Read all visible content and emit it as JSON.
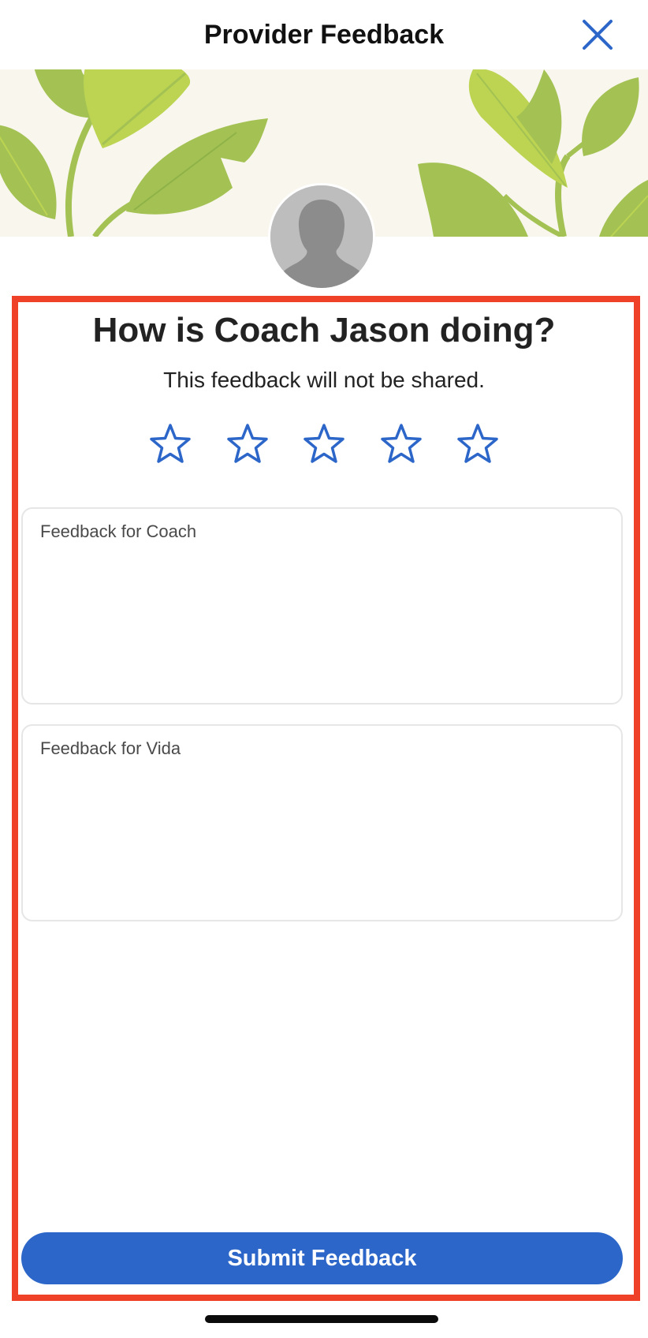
{
  "header": {
    "title": "Provider Feedback",
    "close_icon": "close-icon"
  },
  "banner": {
    "background_color": "#f9f6ee",
    "leaf_colors": [
      "#a3c253",
      "#bcd452",
      "#8fb248"
    ]
  },
  "avatar": {
    "icon": "person-silhouette-icon"
  },
  "prompt": {
    "question": "How is Coach Jason doing?",
    "subtitle": "This feedback will not be shared."
  },
  "rating": {
    "max": 5,
    "value": 0,
    "star_icon": "star-outline-icon",
    "star_color": "#2c66c9"
  },
  "fields": {
    "coach_placeholder": "Feedback for Coach",
    "coach_value": "",
    "vida_placeholder": "Feedback for Vida",
    "vida_value": ""
  },
  "submit": {
    "label": "Submit Feedback",
    "color": "#2c66c9"
  },
  "colors": {
    "highlight_frame": "#ee4128",
    "accent": "#2c66c9"
  }
}
